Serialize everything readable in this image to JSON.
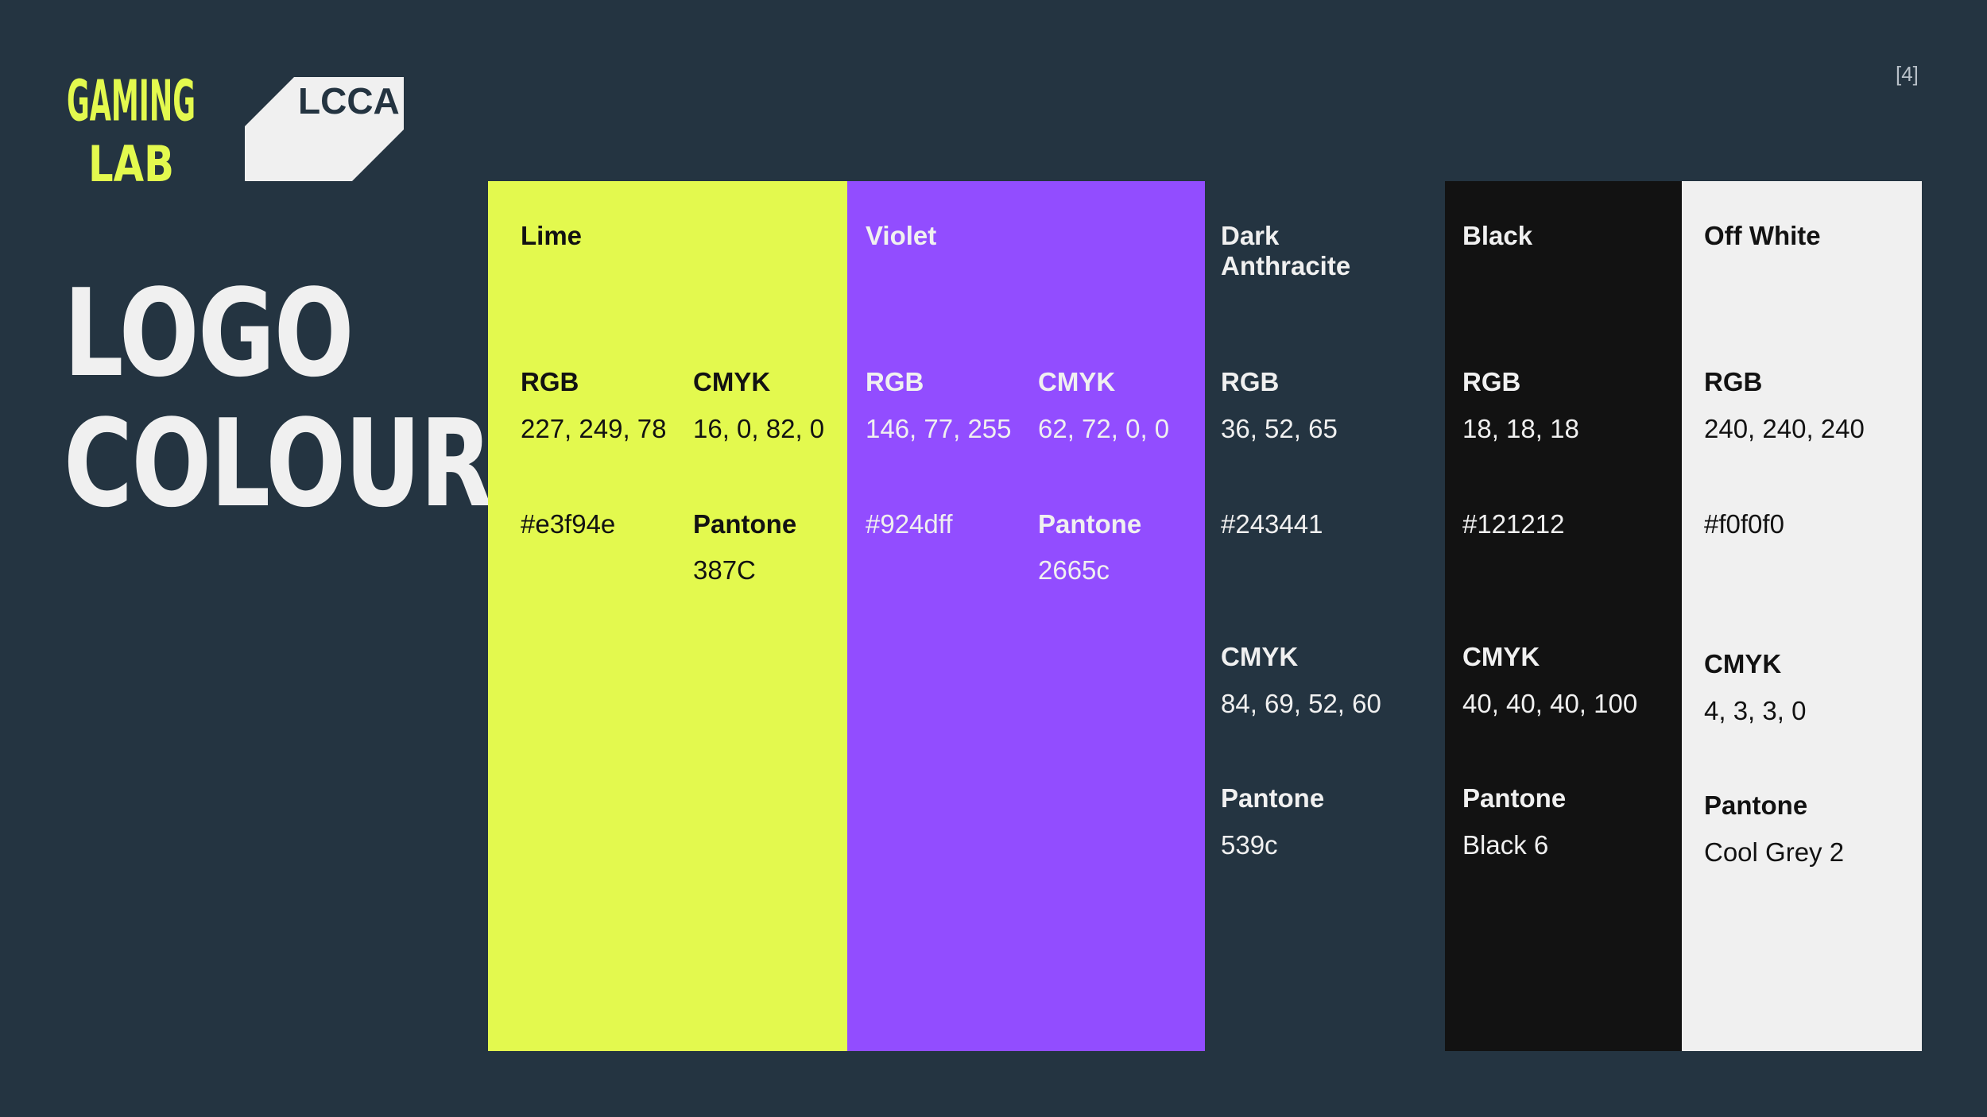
{
  "page_number": "[4]",
  "logos": {
    "gaming_lab": {
      "line1": "GAMING",
      "line2": "LAB",
      "color": "#e3f94e"
    },
    "lcca": {
      "text": "LCCA",
      "color": "#f0f0f0"
    }
  },
  "title": {
    "line1": "LOGO",
    "line2": "COLOURS"
  },
  "swatches": [
    {
      "name": "Lime",
      "color": "#e3f94e",
      "rgb_label": "RGB",
      "rgb": "227, 249, 78",
      "cmyk_label": "CMYK",
      "cmyk": "16, 0, 82, 0",
      "hex": "#e3f94e",
      "pantone_label": "Pantone",
      "pantone": "387C"
    },
    {
      "name": "Violet",
      "color": "#924dff",
      "rgb_label": "RGB",
      "rgb": "146, 77, 255",
      "cmyk_label": "CMYK",
      "cmyk": "62, 72, 0, 0",
      "hex": "#924dff",
      "pantone_label": "Pantone",
      "pantone": "2665c"
    },
    {
      "name": "Dark Anthracite",
      "color": "#243441",
      "rgb_label": "RGB",
      "rgb": "36, 52, 65",
      "hex": "#243441",
      "cmyk_label": "CMYK",
      "cmyk": "84, 69, 52, 60",
      "pantone_label": "Pantone",
      "pantone": "539c"
    },
    {
      "name": "Black",
      "color": "#121212",
      "rgb_label": "RGB",
      "rgb": "18, 18, 18",
      "hex": "#121212",
      "cmyk_label": "CMYK",
      "cmyk": "40, 40, 40, 100",
      "pantone_label": "Pantone",
      "pantone": "Black 6"
    },
    {
      "name": "Off White",
      "color": "#f0f0f0",
      "rgb_label": "RGB",
      "rgb": "240, 240, 240",
      "hex": "#f0f0f0",
      "cmyk_label": "CMYK",
      "cmyk": "4, 3, 3, 0",
      "pantone_label": "Pantone",
      "pantone": "Cool Grey 2"
    }
  ]
}
